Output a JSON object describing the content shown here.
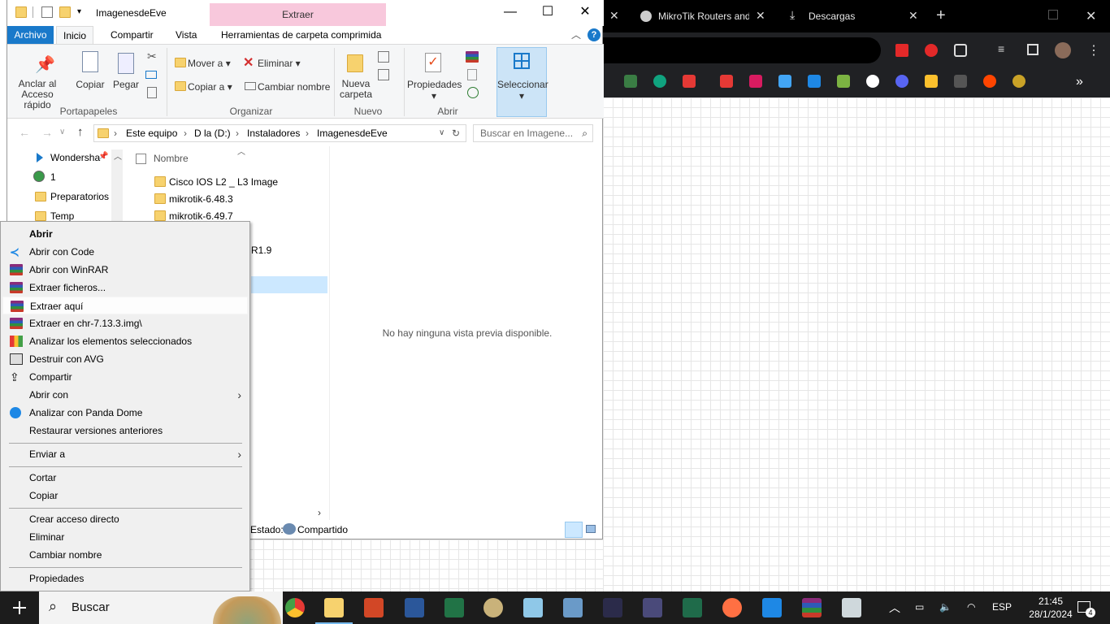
{
  "browser": {
    "tabs": [
      {
        "label": "MikroTik Routers and"
      },
      {
        "label": "Descargas"
      }
    ],
    "new_tab": "+"
  },
  "explorer": {
    "title": "ImagenesdeEve",
    "context_tab_label": "Extraer",
    "ribbon_tabs": {
      "archivo": "Archivo",
      "inicio": "Inicio",
      "compartir": "Compartir",
      "vista": "Vista",
      "herramientas": "Herramientas de carpeta comprimida"
    },
    "ribbon": {
      "anclar": "Anclar al Acceso rápido",
      "copiar": "Copiar",
      "pegar": "Pegar",
      "mover_a": "Mover a",
      "copiar_a": "Copiar a",
      "eliminar": "Eliminar",
      "cambiar_nombre": "Cambiar nombre",
      "nueva_carpeta": "Nueva carpeta",
      "propiedades": "Propiedades",
      "seleccionar": "Seleccionar",
      "groups": {
        "portapapeles": "Portapapeles",
        "organizar": "Organizar",
        "nuevo": "Nuevo",
        "abrir": "Abrir"
      }
    },
    "address": {
      "crumbs": [
        "Este equipo",
        "D la (D:)",
        "Instaladores",
        "ImagenesdeEve"
      ],
      "search_placeholder": "Buscar en Imagene..."
    },
    "nav_items": [
      "Wondersha",
      "1",
      "Preparatorios",
      "Temp"
    ],
    "column_name": "Nombre",
    "files": [
      "Cisco IOS L2 _ L3 Image",
      "mikrotik-6.48.3",
      "mikrotik-6.49.7"
    ],
    "partial_text": "R1.9",
    "preview_message": "No hay ninguna vista previa disponible.",
    "status": {
      "label": "Estado:",
      "value": "Compartido"
    }
  },
  "context_menu": {
    "items": [
      "Abrir",
      "Abrir con Code",
      "Abrir con WinRAR",
      "Extraer ficheros...",
      "Extraer aquí",
      "Extraer en chr-7.13.3.img\\",
      "Analizar los elementos seleccionados",
      "Destruir con AVG",
      "Compartir",
      "Abrir con",
      "Analizar con Panda Dome",
      "Restaurar versiones anteriores",
      "Enviar a",
      "Cortar",
      "Copiar",
      "Crear acceso directo",
      "Eliminar",
      "Cambiar nombre",
      "Propiedades"
    ]
  },
  "taskbar": {
    "search_label": "Buscar",
    "language": "ESP",
    "time": "21:45",
    "date": "28/1/2024",
    "notification_count": "4"
  }
}
